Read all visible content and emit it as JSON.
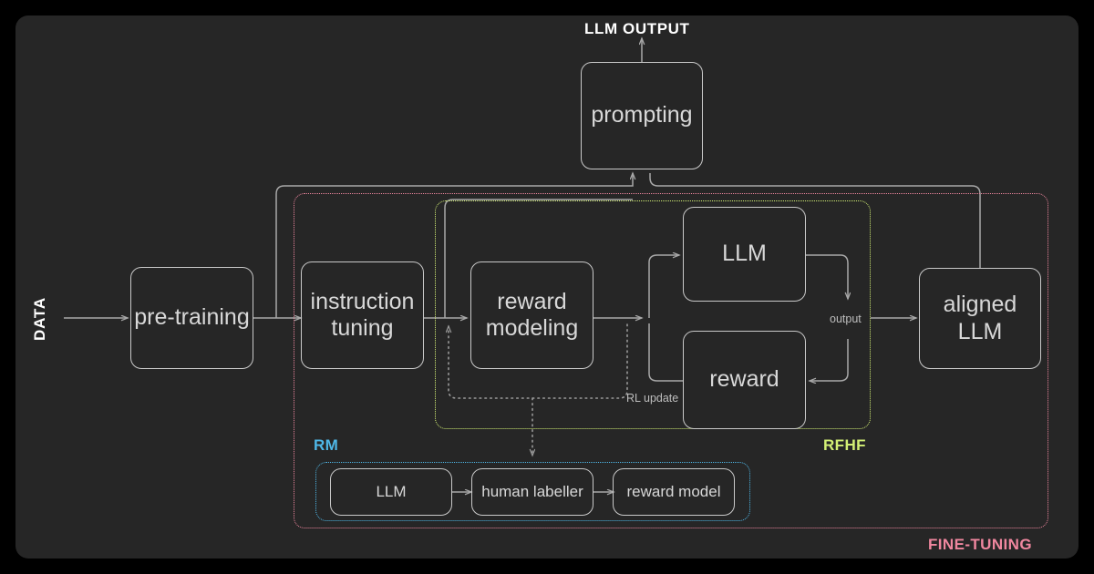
{
  "canvas": {
    "background": "#262626",
    "outer_background": "#000000"
  },
  "diagram": {
    "title_top": "LLM OUTPUT",
    "input_label": "DATA"
  },
  "nodes": [
    {
      "id": "prompting",
      "label": "prompting"
    },
    {
      "id": "pre-training",
      "label": "pre-training"
    },
    {
      "id": "instruction",
      "label": "instruction\ntuning"
    },
    {
      "id": "reward-modeling",
      "label": "reward\nmodeling"
    },
    {
      "id": "llm",
      "label": "LLM"
    },
    {
      "id": "reward",
      "label": "reward"
    },
    {
      "id": "aligned-llm",
      "label": "aligned\nLLM"
    },
    {
      "id": "rm-llm",
      "label": "LLM"
    },
    {
      "id": "human-labeller",
      "label": "human labeller"
    },
    {
      "id": "reward-model",
      "label": "reward model"
    }
  ],
  "edge_labels": {
    "output": "output",
    "rl_update": "RL update"
  },
  "groups": [
    {
      "id": "fine-tuning",
      "label": "FINE-TUNING",
      "color": "#f0879f",
      "style": "dotted"
    },
    {
      "id": "rfhf",
      "label": "RFHF",
      "color": "#d3f075",
      "style": "dotted"
    },
    {
      "id": "rm",
      "label": "RM",
      "color": "#4fb8e8",
      "style": "dotted"
    }
  ],
  "colors": {
    "node_stroke": "#c9c9c9",
    "node_text": "#d8d8d8",
    "wire": "#a8a8a8",
    "dotted_wire": "#9a9a9a",
    "title_text": "#ffffff",
    "fine_tuning": "#f0879f",
    "rfhf": "#d3f075",
    "rm": "#4fb8e8"
  }
}
